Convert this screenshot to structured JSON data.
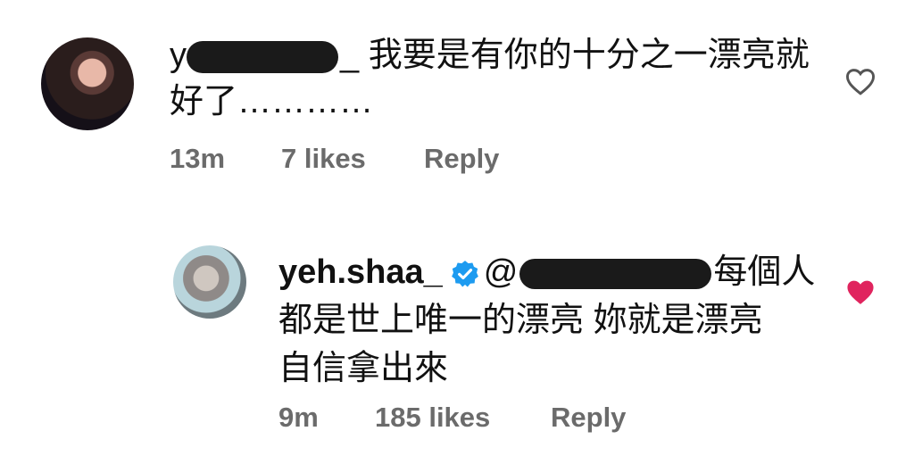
{
  "comment1": {
    "username_redacted": "y",
    "username_suffix": "_",
    "text_line1": "我要是有你的十分之一漂亮就",
    "text_line2": "好了…………",
    "time": "13m",
    "likes": "7 likes",
    "reply_label": "Reply",
    "liked": false
  },
  "comment2": {
    "username": "yeh.shaa_",
    "mention_prefix": "@",
    "text_line1": "每個人",
    "text_line2": "都是世上唯一的漂亮 妳就是漂亮",
    "text_line3": "自信拿出來",
    "time": "9m",
    "likes": "185 likes",
    "reply_label": "Reply",
    "liked": true,
    "verified": true
  },
  "colors": {
    "heart_liked": "#e0245e",
    "verified": "#1d9bf0",
    "meta": "#6b6b6b"
  },
  "icons": [
    "heart-outline-icon",
    "heart-filled-icon",
    "verified-badge-icon"
  ]
}
